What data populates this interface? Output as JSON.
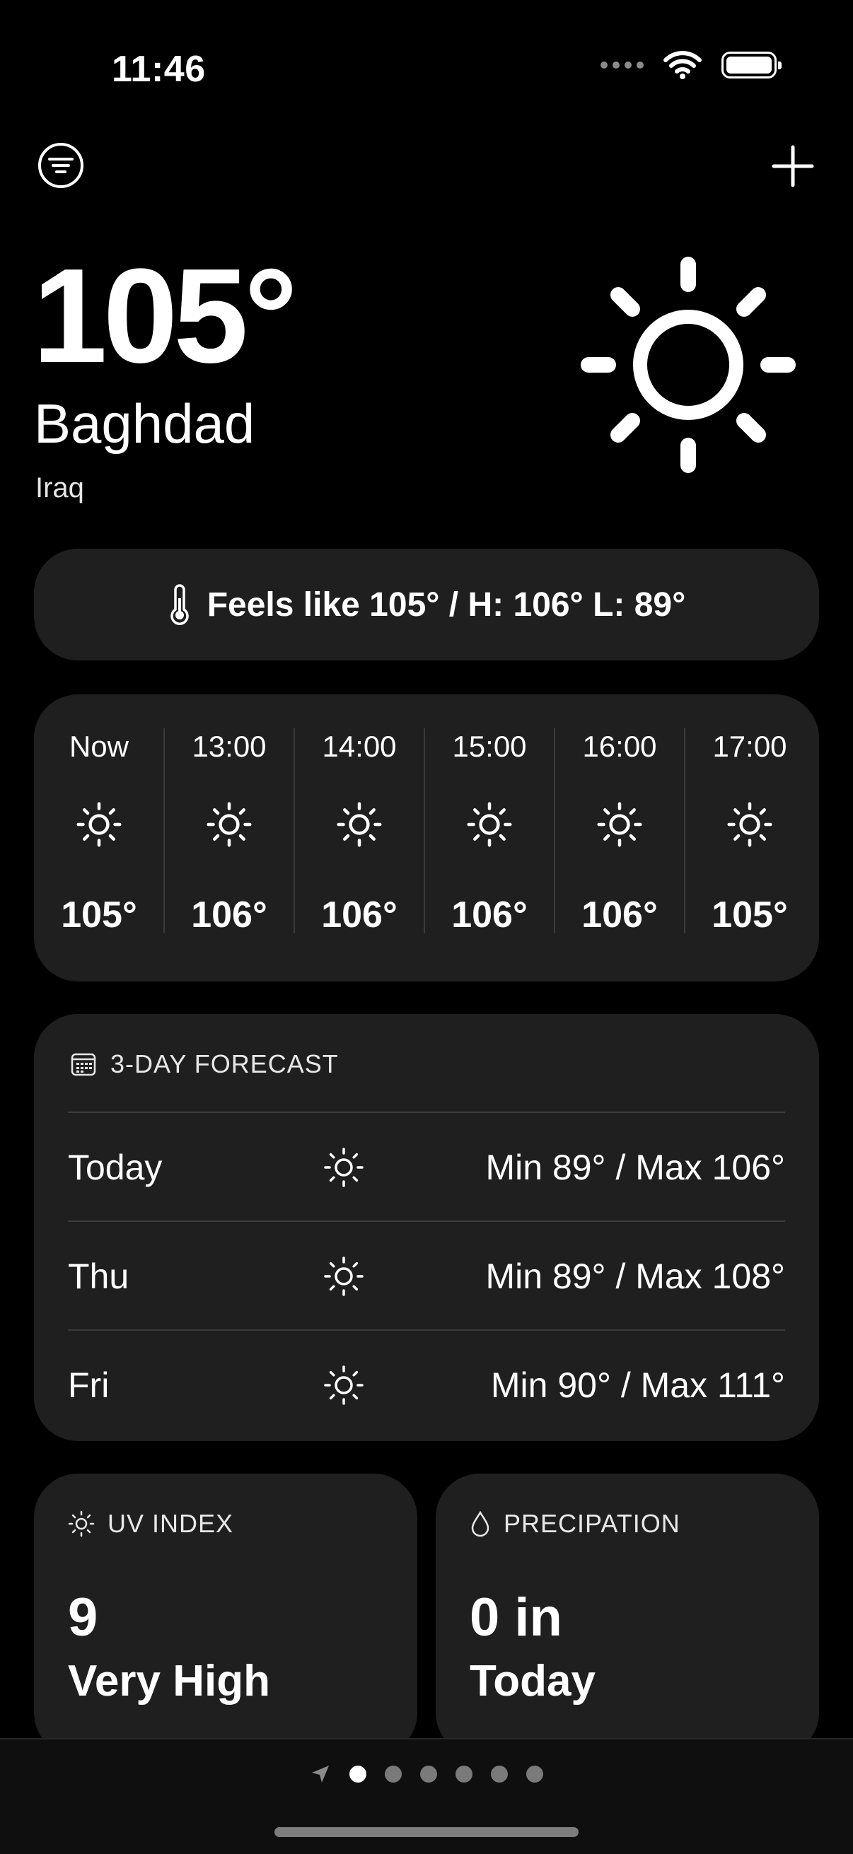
{
  "status_bar": {
    "time": "11:46"
  },
  "header": {
    "menu_icon": "filter-circle-icon",
    "add_icon": "plus-icon"
  },
  "current": {
    "temperature": "105°",
    "city": "Baghdad",
    "country": "Iraq",
    "condition_icon": "sun-icon",
    "feels_like": "Feels like 105° / H: 106° L: 89°"
  },
  "hourly": [
    {
      "label": "Now",
      "temp": "105°",
      "icon": "sun-icon"
    },
    {
      "label": "13:00",
      "temp": "106°",
      "icon": "sun-icon"
    },
    {
      "label": "14:00",
      "temp": "106°",
      "icon": "sun-icon"
    },
    {
      "label": "15:00",
      "temp": "106°",
      "icon": "sun-icon"
    },
    {
      "label": "16:00",
      "temp": "106°",
      "icon": "sun-icon"
    },
    {
      "label": "17:00",
      "temp": "105°",
      "icon": "sun-icon"
    }
  ],
  "forecast": {
    "title": "3-DAY FORECAST",
    "days": [
      {
        "day": "Today",
        "range": "Min 89° / Max 106°",
        "icon": "sun-icon"
      },
      {
        "day": "Thu",
        "range": "Min 89° / Max 108°",
        "icon": "sun-icon"
      },
      {
        "day": "Fri",
        "range": "Min 90° / Max 111°",
        "icon": "sun-icon"
      }
    ]
  },
  "uv": {
    "title": "UV INDEX",
    "value": "9",
    "level": "Very High"
  },
  "precipitation": {
    "title": "PRECIPATION",
    "value": "0 in",
    "period": "Today"
  },
  "pager": {
    "pages": 6,
    "active": 0
  }
}
